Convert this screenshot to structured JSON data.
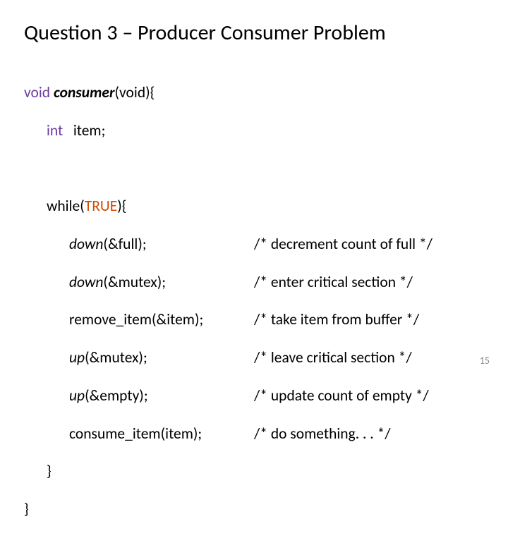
{
  "title": "Question 3 – Producer Consumer Problem",
  "code": {
    "l1": {
      "kw": "void",
      "fn": "consumer",
      "args": "(void){"
    },
    "l2": {
      "kw": "int",
      "rest": "   item;"
    },
    "l3": {
      "pre": "while(",
      "true": "TRUE",
      "post": "){"
    },
    "stmts": [
      {
        "call": "down",
        "args": "(&full);",
        "cmt": "/* decrement count of full */"
      },
      {
        "call": "down",
        "args": "(&mutex);",
        "cmt": "/* enter critical section */"
      },
      {
        "call": "remove_item",
        "plain": true,
        "args": "(&item);",
        "cmt": "/* take item from buffer */"
      },
      {
        "call": "up",
        "args": "(&mutex);",
        "cmt": "/* leave critical section */"
      },
      {
        "call": "up",
        "args": "(&empty);",
        "cmt": "/* update count of empty */"
      },
      {
        "call": "consume_item",
        "plain": true,
        "args": "(item);",
        "cmt": "/* do something. . . */"
      }
    ],
    "close1": "}",
    "close2": "}"
  },
  "page_number": "15"
}
